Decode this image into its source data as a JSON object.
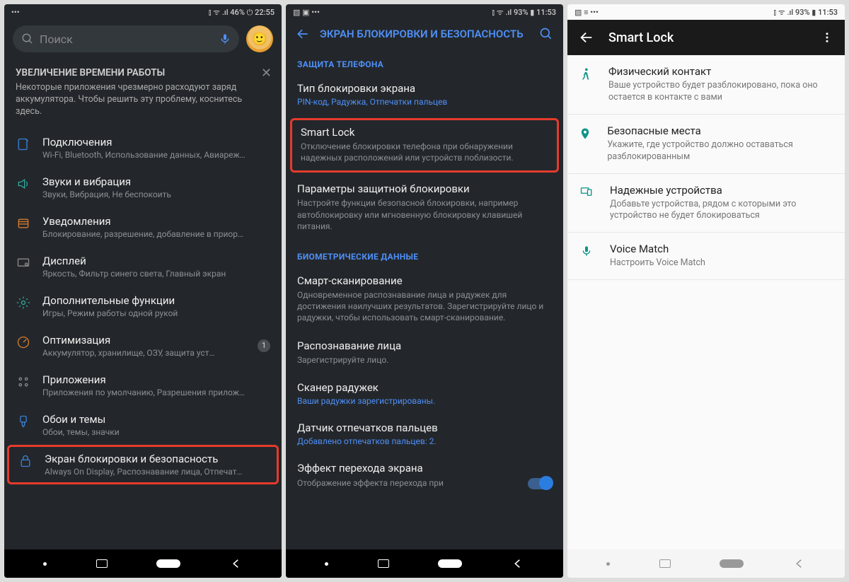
{
  "panel1": {
    "status": {
      "left_icons": "•••",
      "right": "⫾ ᯤ .ıl 46% ⏻ 22:55"
    },
    "search_placeholder": "Поиск",
    "tip": {
      "title": "УВЕЛИЧЕНИЕ ВРЕМЕНИ РАБОТЫ",
      "body": "Некоторые приложения чрезмерно расходуют заряд аккумулятора. Чтобы решить эту проблему, коснитесь здесь."
    },
    "items": [
      {
        "title": "Подключения",
        "sub": "Wi-Fi, Bluetooth, Использование данных, Авиареж…"
      },
      {
        "title": "Звуки и вибрация",
        "sub": "Звуки, Вибрация, Не беспокоить"
      },
      {
        "title": "Уведомления",
        "sub": "Блокирование, разрешение, добавление в приор…"
      },
      {
        "title": "Дисплей",
        "sub": "Яркость, Фильтр синего света, Главный экран"
      },
      {
        "title": "Дополнительные функции",
        "sub": "Игры, Режим работы одной рукой"
      },
      {
        "title": "Оптимизация",
        "sub": "Аккумулятор, хранилище, ОЗУ, защита уст…",
        "badge": "1"
      },
      {
        "title": "Приложения",
        "sub": "Приложения по умолчанию, Разрешения прилож…"
      },
      {
        "title": "Обои и темы",
        "sub": "Обои, темы, значки"
      },
      {
        "title": "Экран блокировки и безопасность",
        "sub": "Always On Display, Распознавание лица, Отпечат…"
      }
    ]
  },
  "panel2": {
    "status": {
      "left_icons": "▧ ▣ •••",
      "right": "⫾ ᯤ .ıl 93% ▮ 11:53"
    },
    "header": "ЭКРАН БЛОКИРОВКИ И БЕЗОПАСНОСТЬ",
    "section1": "ЗАЩИТА ТЕЛЕФОНА",
    "items1": [
      {
        "title": "Тип блокировки экрана",
        "sublink": "PIN-код, Радужка, Отпечатки пальцев"
      },
      {
        "title": "Smart Lock",
        "sub": "Отключение блокировки телефона при обнаружении надежных расположений или устройств поблизости."
      },
      {
        "title": "Параметры защитной блокировки",
        "sub": "Настройте функции безопасной блокировки, например автоблокировку или мгновенную блокировку клавишей питания."
      }
    ],
    "section2": "БИОМЕТРИЧЕСКИЕ ДАННЫЕ",
    "items2": [
      {
        "title": "Смарт-сканирование",
        "sub": "Одновременное распознавание лица и радужек для достижения наилучших результатов. Зарегистрируйте лицо и радужки, чтобы использовать смарт-сканирование."
      },
      {
        "title": "Распознавание лица",
        "sub": "Зарегистрируйте лицо."
      },
      {
        "title": "Сканер радужек",
        "sublink": "Ваши радужки зарегистрированы."
      },
      {
        "title": "Датчик отпечатков пальцев",
        "sublink": "Добавлено отпечатков пальцев: 2."
      },
      {
        "title": "Эффект перехода экрана",
        "sub": "Отображение эффекта перехода при",
        "toggle": true
      }
    ]
  },
  "panel3": {
    "status": {
      "left_icons": "▧ ≡ •••",
      "right": "⫾ ᯤ .ıl 93% ▮ 11:53"
    },
    "header": "Smart Lock",
    "items": [
      {
        "title": "Физический контакт",
        "sub": "Ваше устройство будет разблокировано, пока оно остается в контакте с вами"
      },
      {
        "title": "Безопасные места",
        "sub": "Укажите, где устройство должно оставаться разблокированным"
      },
      {
        "title": "Надежные устройства",
        "sub": "Добавьте устройства, рядом с которыми это устройство не будет блокироваться"
      },
      {
        "title": "Voice Match",
        "sub": "Настроить Voice Match"
      }
    ]
  }
}
